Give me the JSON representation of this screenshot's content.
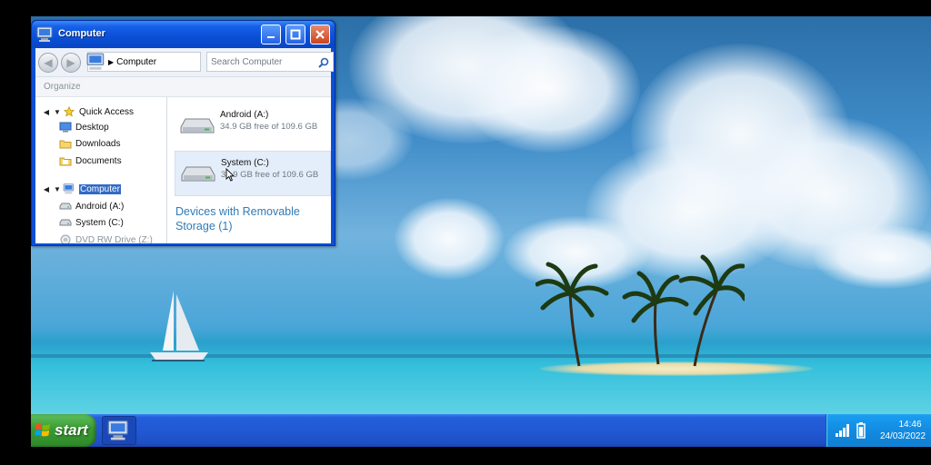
{
  "window": {
    "title": "Computer",
    "address": "Computer",
    "search_placeholder": "Search Computer",
    "toolbar": {
      "organize_label": "Organize"
    },
    "nav": {
      "quick_access": "Quick Access",
      "desktop": "Desktop",
      "downloads": "Downloads",
      "documents": "Documents",
      "computer": "Computer",
      "android": "Android (A:)",
      "system": "System (C:)",
      "dvd": "DVD RW Drive (Z:)"
    },
    "drives": [
      {
        "name": "Android (A:)",
        "free": "34.9 GB free of 109.6 GB"
      },
      {
        "name": "System (C:)",
        "free": "34.9 GB free of 109.6 GB"
      }
    ],
    "devices_header": "Devices with Removable Storage (1)"
  },
  "taskbar": {
    "start_label": "start",
    "clock_time": "14:46",
    "clock_date": "24/03/2022"
  },
  "colors": {
    "titlebar": "#0a4fd6",
    "taskbar": "#245edb",
    "start": "#3a9a33",
    "selection": "#316ac5",
    "section_header": "#2f7bb8"
  },
  "icons": [
    "computer-icon",
    "back-icon",
    "forward-icon",
    "chevron-right-icon",
    "search-icon",
    "star-icon",
    "desktop-icon",
    "folder-icon",
    "drive-icon",
    "dvd-icon",
    "minimize-icon",
    "maximize-icon",
    "close-icon",
    "windows-logo-icon",
    "signal-icon",
    "battery-icon",
    "mouse-cursor-icon"
  ]
}
